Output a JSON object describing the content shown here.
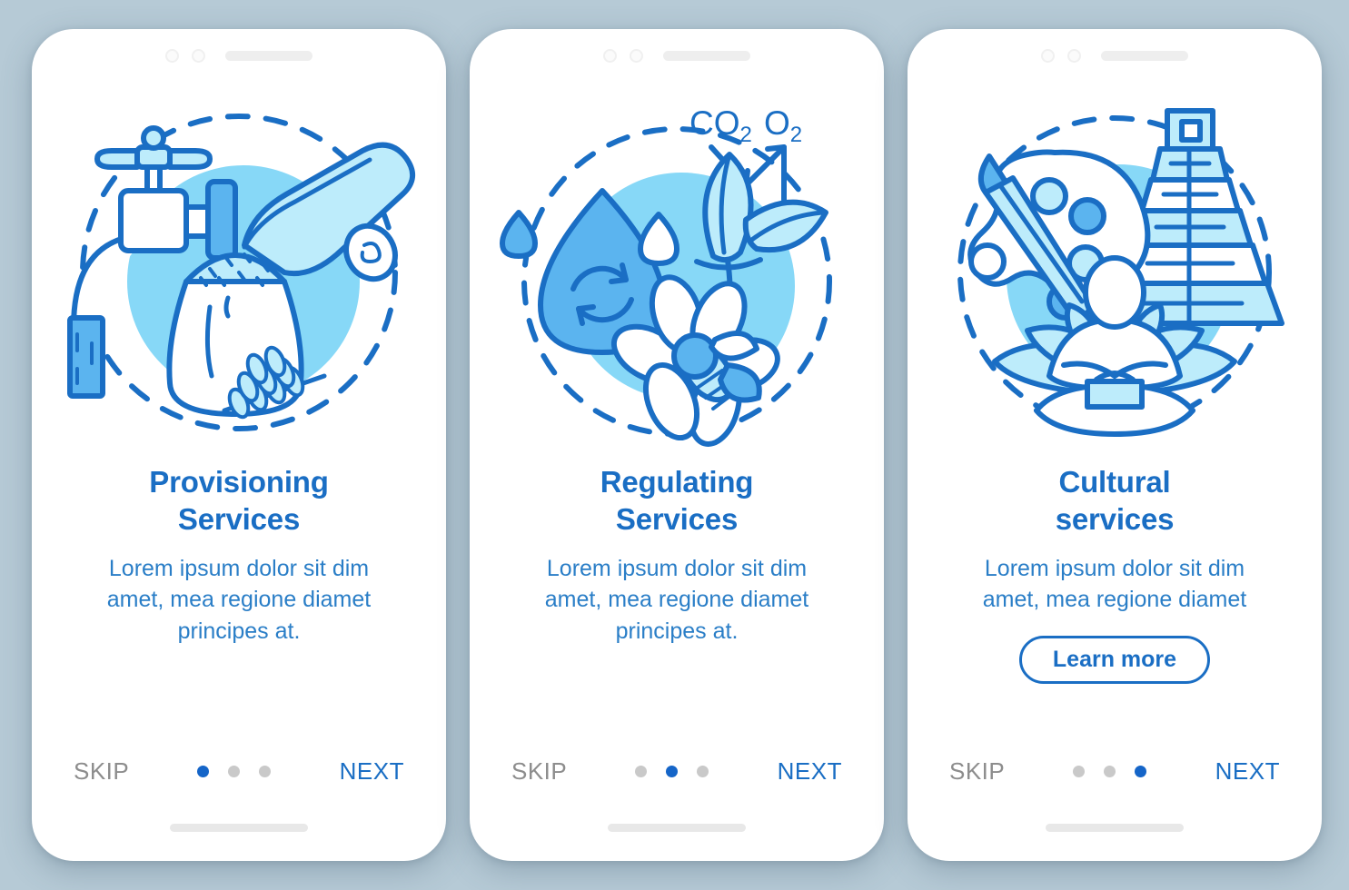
{
  "theme": {
    "page_background": "#b6cad6",
    "card_background": "#ffffff",
    "title_blue": "#1a6ec4",
    "body_blue": "#2a7ec7",
    "accent_blue": "#1565c8",
    "line_blue": "#1a6ec4",
    "fill_light_cyan": "#bdecfb",
    "circle_cyan": "#87d8f7",
    "mid_blue": "#5bb4ef",
    "dot_inactive": "#c9c9c9",
    "skip_gray": "#8d8d8d"
  },
  "screens": [
    {
      "id": "provisioning",
      "illustration_name": "provisioning-services-illustration",
      "illustration_items": [
        "water-faucet-icon",
        "wood-log-icon",
        "grain-sack-icon",
        "wheat-ears-icon"
      ],
      "title": "Provisioning\nServices",
      "title_lines": [
        "Provisioning",
        "Services"
      ],
      "body": "Lorem ipsum dolor sit dim amet, mea regione diamet principes at.",
      "body_lines": [
        "Lorem ipsum dolor sit dim",
        "amet, mea regione diamet",
        "principes at."
      ],
      "has_learn_more": false,
      "learn_more_label": "",
      "nav": {
        "skip": "SKIP",
        "next": "NEXT",
        "dot_count": 3,
        "active_dot": 1
      }
    },
    {
      "id": "regulating",
      "illustration_name": "regulating-services-illustration",
      "illustration_items": [
        "water-droplet-recycle-icon",
        "plant-leaves-icon",
        "co2-o2-arrows-icon",
        "flower-bee-icon"
      ],
      "title": "Regulating\nServices",
      "title_lines": [
        "Regulating",
        "Services"
      ],
      "body": "Lorem ipsum dolor sit dim amet, mea regione diamet principes at.",
      "body_lines": [
        "Lorem ipsum dolor sit dim",
        "amet, mea regione diamet",
        "principes at."
      ],
      "labels": {
        "co2": "CO",
        "co2_sub": "2",
        "o2": "O",
        "o2_sub": "2"
      },
      "has_learn_more": false,
      "learn_more_label": "",
      "nav": {
        "skip": "SKIP",
        "next": "NEXT",
        "dot_count": 3,
        "active_dot": 2
      }
    },
    {
      "id": "cultural",
      "illustration_name": "cultural-services-illustration",
      "illustration_items": [
        "paint-palette-brush-icon",
        "mayan-pyramid-icon",
        "meditating-person-lotus-icon"
      ],
      "title": "Cultural\nservices",
      "title_lines": [
        "Cultural",
        "services"
      ],
      "body": "Lorem ipsum dolor sit dim amet, mea regione diamet",
      "body_lines": [
        "Lorem ipsum dolor sit dim",
        "amet, mea regione diamet"
      ],
      "has_learn_more": true,
      "learn_more_label": "Learn more",
      "nav": {
        "skip": "SKIP",
        "next": "NEXT",
        "dot_count": 3,
        "active_dot": 3
      }
    }
  ]
}
